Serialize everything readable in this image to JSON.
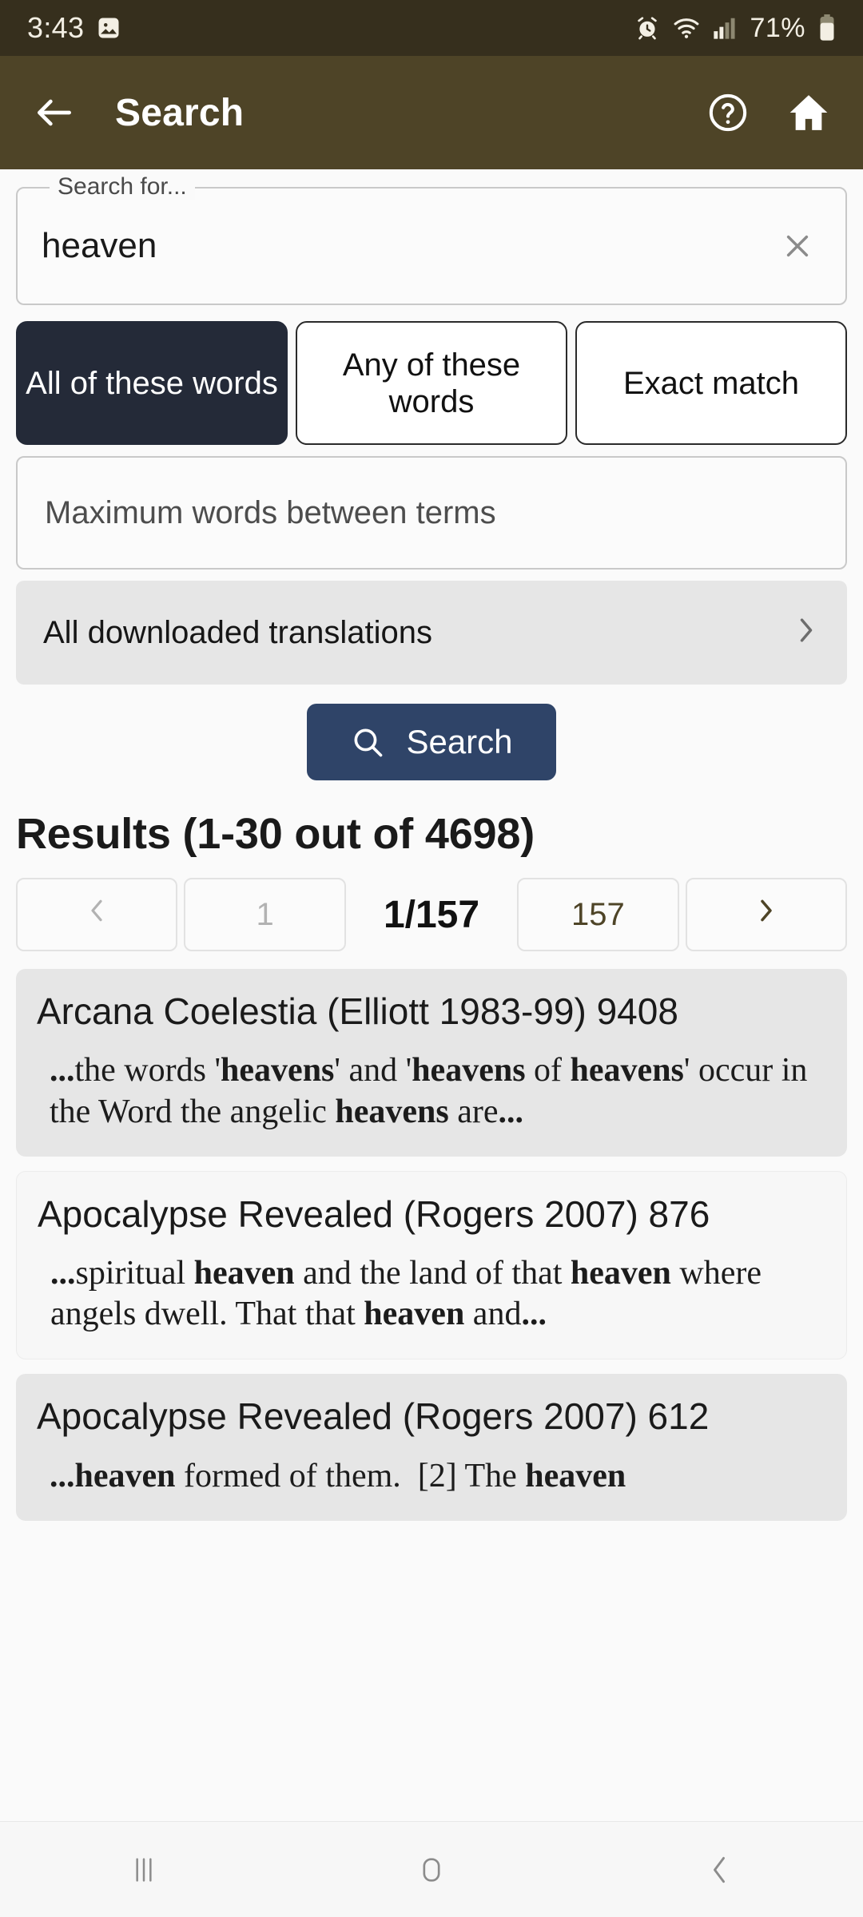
{
  "status_bar": {
    "time": "3:43",
    "battery_percent": "71%",
    "icons": [
      "image-icon",
      "alarm-icon",
      "wifi-icon",
      "cellular-signal-icon",
      "battery-icon"
    ]
  },
  "app_bar": {
    "back_icon": "back-arrow-icon",
    "title": "Search",
    "help_icon": "help-circle-icon",
    "home_icon": "home-icon"
  },
  "search_form": {
    "field_label": "Search for...",
    "field_value": "heaven",
    "clear_icon": "close-x-icon",
    "match_modes": [
      {
        "label": "All of these words",
        "selected": true
      },
      {
        "label": "Any of these words",
        "selected": false
      },
      {
        "label": "Exact match",
        "selected": false
      }
    ],
    "max_words_placeholder": "Maximum words between terms",
    "max_words_value": "",
    "translations_label": "All downloaded translations",
    "translations_chevron": "chevron-right-icon",
    "search_button_label": "Search",
    "search_button_icon": "magnifier-icon",
    "accent_selected_bg": "#242a38",
    "search_button_bg": "#2f4468"
  },
  "results": {
    "heading": "Results (1-30 out of 4698)",
    "pagination": {
      "prev_icon": "chevron-left-icon",
      "first_page": "1",
      "current": "1/157",
      "last_page": "157",
      "next_icon": "chevron-right-icon"
    },
    "items": [
      {
        "title": "Arcana Coelestia (Elliott 1983-99) 9408",
        "snippet_html": "<b>...</b>the words '<b>heavens</b>' and '<b>heavens</b> of <b>heavens</b>' occur in the Word the angelic <b>heavens</b> are<b>...</b>"
      },
      {
        "title": "Apocalypse Revealed (Rogers 2007) 876",
        "snippet_html": "<b>...</b>spiritual <b>heaven</b> and the land of that <b>heaven</b> where angels dwell. That that <b>heaven</b> and<b>...</b>"
      },
      {
        "title": "Apocalypse Revealed (Rogers 2007) 612",
        "snippet_html": "<b>...heaven</b> formed of them.&nbsp; [2] The <b>heaven</b>"
      }
    ]
  },
  "nav_bar": {
    "recents_icon": "recents-icon",
    "home_icon": "home-square-icon",
    "back_icon": "back-chevron-icon"
  }
}
